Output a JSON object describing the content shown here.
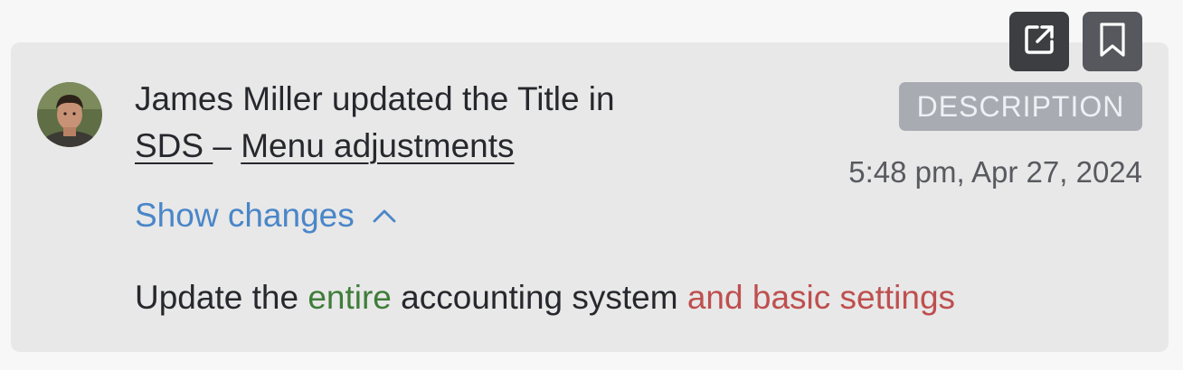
{
  "activity": {
    "user": "James Miller",
    "action_text": " updated the Title in",
    "project_link": "SDS ",
    "separator": "– ",
    "item_link": "Menu adjustments",
    "badge": "DESCRIPTION",
    "timestamp": "5:48 pm, Apr 27, 2024",
    "show_changes_label": "Show changes"
  },
  "diff": {
    "part1": "Update the ",
    "added": "entire",
    "part2": " accounting system ",
    "removed": "and basic settings"
  },
  "icons": {
    "open": "open-external-icon",
    "bookmark": "bookmark-icon",
    "chevron": "chevron-up-icon"
  },
  "colors": {
    "link_blue": "#4a86c8",
    "added_green": "#3f7d3a",
    "removed_red": "#bf4f4f",
    "badge_bg": "#a9abb3"
  }
}
